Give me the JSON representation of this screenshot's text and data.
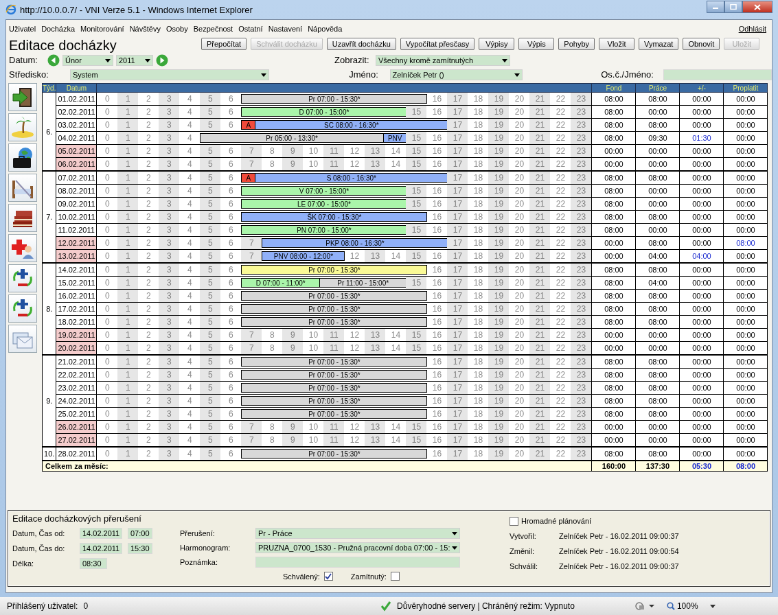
{
  "window": {
    "title": "http://10.0.0.7/ - VNI Verze 5.1 - Windows Internet Explorer"
  },
  "menu": [
    "Uživatel",
    "Docházka",
    "Monitorování",
    "Návštěvy",
    "Osoby",
    "Bezpečnost",
    "Ostatní",
    "Nastavení",
    "Nápověda"
  ],
  "logout": "Odhlásit",
  "page_title": "Editace docházky",
  "toolbar": [
    {
      "label": "Přepočítat",
      "disabled": false
    },
    {
      "label": "Schválit docházku",
      "disabled": true
    },
    {
      "label": "Uzavřít docházku",
      "disabled": false
    },
    {
      "label": "Vypočítat přesčasy",
      "disabled": false
    },
    {
      "label": "Výpisy",
      "disabled": false
    },
    {
      "label": "Výpis",
      "disabled": false
    },
    {
      "label": "Pohyby",
      "disabled": false
    },
    {
      "label": "Vložit",
      "disabled": false
    },
    {
      "label": "Vymazat",
      "disabled": false
    },
    {
      "label": "Obnovit",
      "disabled": false
    },
    {
      "label": "Uložit",
      "disabled": true
    }
  ],
  "filters": {
    "date_label": "Datum:",
    "month": "Únor",
    "year": "2011",
    "show_label": "Zobrazit:",
    "show": "Všechny kromě zamítnutých",
    "center_label": "Středisko:",
    "center": "System",
    "name_label": "Jméno:",
    "name": "Zelníček Petr ()",
    "id_label": "Os.č./Jméno:"
  },
  "sidebar": [
    {
      "kind": "exit"
    },
    {
      "kind": "vacation"
    },
    {
      "kind": "trip"
    },
    {
      "kind": "rest"
    },
    {
      "kind": "books"
    },
    {
      "kind": "medical"
    },
    {
      "kind": "cycle"
    },
    {
      "kind": "cycle"
    },
    {
      "kind": "cards"
    }
  ],
  "table": {
    "columns": {
      "week": "Týd.",
      "date": "Datum",
      "fond": "Fond",
      "work": "Práce",
      "diff": "+/-",
      "payout": "Proplatit"
    },
    "weeks": [
      {
        "label": "6.",
        "days": [
          {
            "date": "01.02.2011",
            "weekend": false,
            "hours_before": [
              "0",
              "1",
              "2",
              "3",
              "4",
              "5",
              "6"
            ],
            "bars": [
              {
                "label": "Pr 07:00 - 15:30*",
                "color": "#d8d8d8"
              }
            ],
            "hours_after": [
              "16",
              "17",
              "18",
              "19",
              "20",
              "21",
              "22",
              "23"
            ],
            "fond": "08:00",
            "work": "08:00",
            "diff": "00:00",
            "diff_marked": false,
            "payout": "00:00",
            "payout_marked": false
          },
          {
            "date": "02.02.2011",
            "weekend": false,
            "hours_before": [
              "0",
              "1",
              "2",
              "3",
              "4",
              "5",
              "6"
            ],
            "bars": [
              {
                "label": "D 07:00 - 15:00*",
                "color": "#aaf5aa"
              }
            ],
            "hours_after": [
              "15",
              "16",
              "17",
              "18",
              "19",
              "20",
              "21",
              "22",
              "23"
            ],
            "fond": "08:00",
            "work": "00:00",
            "diff": "00:00",
            "diff_marked": false,
            "payout": "00:00",
            "payout_marked": false
          },
          {
            "date": "03.02.2011",
            "weekend": false,
            "hours_before": [
              "0",
              "1",
              "2",
              "3",
              "4",
              "5",
              "6"
            ],
            "bars": [
              {
                "label": "A",
                "color": "#f04a3a"
              },
              {
                "label": "SC 08:00 - 16:30*",
                "color": "#90b0f8"
              }
            ],
            "hours_after": [
              "17",
              "18",
              "19",
              "20",
              "21",
              "22",
              "23"
            ],
            "fond": "08:00",
            "work": "08:00",
            "diff": "00:00",
            "diff_marked": false,
            "payout": "00:00",
            "payout_marked": false
          },
          {
            "date": "04.02.2011",
            "weekend": false,
            "hours_before": [
              "0",
              "1",
              "2",
              "3",
              "4"
            ],
            "bars": [
              {
                "label": "Pr 05:00 - 13:30*",
                "color": "#d8d8d8"
              },
              {
                "label": "PNV",
                "color": "#90b0f8"
              }
            ],
            "hours_after": [
              "15",
              "16",
              "17",
              "18",
              "19",
              "20",
              "21",
              "22",
              "23"
            ],
            "fond": "08:00",
            "work": "09:30",
            "diff": "01:30",
            "diff_marked": true,
            "payout": "00:00",
            "payout_marked": false
          },
          {
            "date": "05.02.2011",
            "weekend": true,
            "hours_before": [
              "0",
              "1",
              "2",
              "3",
              "4",
              "5",
              "6",
              "7",
              "8",
              "9",
              "10",
              "11",
              "12",
              "13",
              "14",
              "15",
              "16",
              "17",
              "18",
              "19",
              "20",
              "21",
              "22",
              "23"
            ],
            "fond": "00:00",
            "work": "00:00",
            "diff": "00:00",
            "diff_marked": false,
            "payout": "00:00",
            "payout_marked": false
          },
          {
            "date": "06.02.2011",
            "weekend": true,
            "hours_before": [
              "0",
              "1",
              "2",
              "3",
              "4",
              "5",
              "6",
              "7",
              "8",
              "9",
              "10",
              "11",
              "12",
              "13",
              "14",
              "15",
              "16",
              "17",
              "18",
              "19",
              "20",
              "21",
              "22",
              "23"
            ],
            "fond": "00:00",
            "work": "00:00",
            "diff": "00:00",
            "diff_marked": false,
            "payout": "00:00",
            "payout_marked": false
          }
        ]
      },
      {
        "label": "7.",
        "days": [
          {
            "date": "07.02.2011",
            "weekend": false,
            "hours_before": [
              "0",
              "1",
              "2",
              "3",
              "4",
              "5",
              "6"
            ],
            "bars": [
              {
                "label": "A",
                "color": "#f04a3a"
              },
              {
                "label": "S 08:00 - 16:30*",
                "color": "#90b0f8"
              }
            ],
            "hours_after": [
              "17",
              "18",
              "19",
              "20",
              "21",
              "22",
              "23"
            ],
            "fond": "08:00",
            "work": "08:00",
            "diff": "00:00",
            "diff_marked": false,
            "payout": "00:00",
            "payout_marked": false
          },
          {
            "date": "08.02.2011",
            "weekend": false,
            "hours_before": [
              "0",
              "1",
              "2",
              "3",
              "4",
              "5",
              "6"
            ],
            "bars": [
              {
                "label": "V 07:00 - 15:00*",
                "color": "#aaf5aa"
              }
            ],
            "hours_after": [
              "15",
              "16",
              "17",
              "18",
              "19",
              "20",
              "21",
              "22",
              "23"
            ],
            "fond": "08:00",
            "work": "00:00",
            "diff": "00:00",
            "diff_marked": false,
            "payout": "00:00",
            "payout_marked": false
          },
          {
            "date": "09.02.2011",
            "weekend": false,
            "hours_before": [
              "0",
              "1",
              "2",
              "3",
              "4",
              "5",
              "6"
            ],
            "bars": [
              {
                "label": "LE 07:00 - 15:00*",
                "color": "#aaf5aa"
              }
            ],
            "hours_after": [
              "15",
              "16",
              "17",
              "18",
              "19",
              "20",
              "21",
              "22",
              "23"
            ],
            "fond": "08:00",
            "work": "00:00",
            "diff": "00:00",
            "diff_marked": false,
            "payout": "00:00",
            "payout_marked": false
          },
          {
            "date": "10.02.2011",
            "weekend": false,
            "hours_before": [
              "0",
              "1",
              "2",
              "3",
              "4",
              "5",
              "6"
            ],
            "bars": [
              {
                "label": "ŠK 07:00 - 15:30*",
                "color": "#90b0f8"
              }
            ],
            "hours_after": [
              "16",
              "17",
              "18",
              "19",
              "20",
              "21",
              "22",
              "23"
            ],
            "fond": "08:00",
            "work": "08:00",
            "diff": "00:00",
            "diff_marked": false,
            "payout": "00:00",
            "payout_marked": false
          },
          {
            "date": "11.02.2011",
            "weekend": false,
            "hours_before": [
              "0",
              "1",
              "2",
              "3",
              "4",
              "5",
              "6"
            ],
            "bars": [
              {
                "label": "PN 07:00 - 15:00*",
                "color": "#aaf5aa"
              }
            ],
            "hours_after": [
              "15",
              "16",
              "17",
              "18",
              "19",
              "20",
              "21",
              "22",
              "23"
            ],
            "fond": "08:00",
            "work": "00:00",
            "diff": "00:00",
            "diff_marked": false,
            "payout": "00:00",
            "payout_marked": false
          },
          {
            "date": "12.02.2011",
            "weekend": true,
            "hours_before": [
              "0",
              "1",
              "2",
              "3",
              "4",
              "5",
              "6",
              "7"
            ],
            "bars": [
              {
                "label": "PKP 08:00 - 16:30*",
                "color": "#90b0f8"
              }
            ],
            "hours_after": [
              "17",
              "18",
              "19",
              "20",
              "21",
              "22",
              "23"
            ],
            "fond": "00:00",
            "work": "08:00",
            "diff": "00:00",
            "diff_marked": false,
            "payout": "08:00",
            "payout_marked": true
          },
          {
            "date": "13.02.2011",
            "weekend": true,
            "hours_before": [
              "0",
              "1",
              "2",
              "3",
              "4",
              "5",
              "6",
              "7"
            ],
            "bars": [
              {
                "label": "PNV 08:00 - 12:00*",
                "color": "#90b0f8"
              }
            ],
            "hours_after": [
              "12",
              "13",
              "14",
              "15",
              "16",
              "17",
              "18",
              "19",
              "20",
              "21",
              "22",
              "23"
            ],
            "fond": "00:00",
            "work": "04:00",
            "diff": "04:00",
            "diff_marked": true,
            "payout": "00:00",
            "payout_marked": false
          }
        ]
      },
      {
        "label": "8.",
        "days": [
          {
            "date": "14.02.2011",
            "weekend": false,
            "hours_before": [
              "0",
              "1",
              "2",
              "3",
              "4",
              "5",
              "6"
            ],
            "bars": [
              {
                "label": "Pr 07:00 - 15:30*",
                "color": "#fafa96"
              }
            ],
            "hours_after": [
              "16",
              "17",
              "18",
              "19",
              "20",
              "21",
              "22",
              "23"
            ],
            "fond": "08:00",
            "work": "08:00",
            "diff": "00:00",
            "diff_marked": false,
            "payout": "00:00",
            "payout_marked": false
          },
          {
            "date": "15.02.2011",
            "weekend": false,
            "hours_before": [
              "0",
              "1",
              "2",
              "3",
              "4",
              "5",
              "6"
            ],
            "bars": [
              {
                "label": "D 07:00 - 11:00*",
                "color": "#aaf5aa"
              },
              {
                "label": "Pr 11:00 - 15:00*",
                "color": "#d8d8d8"
              }
            ],
            "hours_after": [
              "15",
              "16",
              "17",
              "18",
              "19",
              "20",
              "21",
              "22",
              "23"
            ],
            "fond": "08:00",
            "work": "04:00",
            "diff": "00:00",
            "diff_marked": false,
            "payout": "00:00",
            "payout_marked": false
          },
          {
            "date": "16.02.2011",
            "weekend": false,
            "hours_before": [
              "0",
              "1",
              "2",
              "3",
              "4",
              "5",
              "6"
            ],
            "bars": [
              {
                "label": "Pr 07:00 - 15:30*",
                "color": "#d8d8d8"
              }
            ],
            "hours_after": [
              "16",
              "17",
              "18",
              "19",
              "20",
              "21",
              "22",
              "23"
            ],
            "fond": "08:00",
            "work": "08:00",
            "diff": "00:00",
            "diff_marked": false,
            "payout": "00:00",
            "payout_marked": false
          },
          {
            "date": "17.02.2011",
            "weekend": false,
            "hours_before": [
              "0",
              "1",
              "2",
              "3",
              "4",
              "5",
              "6"
            ],
            "bars": [
              {
                "label": "Pr 07:00 - 15:30*",
                "color": "#d8d8d8"
              }
            ],
            "hours_after": [
              "16",
              "17",
              "18",
              "19",
              "20",
              "21",
              "22",
              "23"
            ],
            "fond": "08:00",
            "work": "08:00",
            "diff": "00:00",
            "diff_marked": false,
            "payout": "00:00",
            "payout_marked": false
          },
          {
            "date": "18.02.2011",
            "weekend": false,
            "hours_before": [
              "0",
              "1",
              "2",
              "3",
              "4",
              "5",
              "6"
            ],
            "bars": [
              {
                "label": "Pr 07:00 - 15:30*",
                "color": "#d8d8d8"
              }
            ],
            "hours_after": [
              "16",
              "17",
              "18",
              "19",
              "20",
              "21",
              "22",
              "23"
            ],
            "fond": "08:00",
            "work": "08:00",
            "diff": "00:00",
            "diff_marked": false,
            "payout": "00:00",
            "payout_marked": false
          },
          {
            "date": "19.02.2011",
            "weekend": true,
            "hours_before": [
              "0",
              "1",
              "2",
              "3",
              "4",
              "5",
              "6",
              "7",
              "8",
              "9",
              "10",
              "11",
              "12",
              "13",
              "14",
              "15",
              "16",
              "17",
              "18",
              "19",
              "20",
              "21",
              "22",
              "23"
            ],
            "fond": "00:00",
            "work": "00:00",
            "diff": "00:00",
            "diff_marked": false,
            "payout": "00:00",
            "payout_marked": false
          },
          {
            "date": "20.02.2011",
            "weekend": true,
            "hours_before": [
              "0",
              "1",
              "2",
              "3",
              "4",
              "5",
              "6",
              "7",
              "8",
              "9",
              "10",
              "11",
              "12",
              "13",
              "14",
              "15",
              "16",
              "17",
              "18",
              "19",
              "20",
              "21",
              "22",
              "23"
            ],
            "fond": "00:00",
            "work": "00:00",
            "diff": "00:00",
            "diff_marked": false,
            "payout": "00:00",
            "payout_marked": false
          }
        ]
      },
      {
        "label": "9.",
        "days": [
          {
            "date": "21.02.2011",
            "weekend": false,
            "hours_before": [
              "0",
              "1",
              "2",
              "3",
              "4",
              "5",
              "6"
            ],
            "bars": [
              {
                "label": "Pr 07:00 - 15:30*",
                "color": "#d8d8d8"
              }
            ],
            "hours_after": [
              "16",
              "17",
              "18",
              "19",
              "20",
              "21",
              "22",
              "23"
            ],
            "fond": "08:00",
            "work": "08:00",
            "diff": "00:00",
            "diff_marked": false,
            "payout": "00:00",
            "payout_marked": false
          },
          {
            "date": "22.02.2011",
            "weekend": false,
            "hours_before": [
              "0",
              "1",
              "2",
              "3",
              "4",
              "5",
              "6"
            ],
            "bars": [
              {
                "label": "Pr 07:00 - 15:30*",
                "color": "#d8d8d8"
              }
            ],
            "hours_after": [
              "16",
              "17",
              "18",
              "19",
              "20",
              "21",
              "22",
              "23"
            ],
            "fond": "08:00",
            "work": "08:00",
            "diff": "00:00",
            "diff_marked": false,
            "payout": "00:00",
            "payout_marked": false
          },
          {
            "date": "23.02.2011",
            "weekend": false,
            "hours_before": [
              "0",
              "1",
              "2",
              "3",
              "4",
              "5",
              "6"
            ],
            "bars": [
              {
                "label": "Pr 07:00 - 15:30*",
                "color": "#d8d8d8"
              }
            ],
            "hours_after": [
              "16",
              "17",
              "18",
              "19",
              "20",
              "21",
              "22",
              "23"
            ],
            "fond": "08:00",
            "work": "08:00",
            "diff": "00:00",
            "diff_marked": false,
            "payout": "00:00",
            "payout_marked": false
          },
          {
            "date": "24.02.2011",
            "weekend": false,
            "hours_before": [
              "0",
              "1",
              "2",
              "3",
              "4",
              "5",
              "6"
            ],
            "bars": [
              {
                "label": "Pr 07:00 - 15:30*",
                "color": "#d8d8d8"
              }
            ],
            "hours_after": [
              "16",
              "17",
              "18",
              "19",
              "20",
              "21",
              "22",
              "23"
            ],
            "fond": "08:00",
            "work": "08:00",
            "diff": "00:00",
            "diff_marked": false,
            "payout": "00:00",
            "payout_marked": false
          },
          {
            "date": "25.02.2011",
            "weekend": false,
            "hours_before": [
              "0",
              "1",
              "2",
              "3",
              "4",
              "5",
              "6"
            ],
            "bars": [
              {
                "label": "Pr 07:00 - 15:30*",
                "color": "#d8d8d8"
              }
            ],
            "hours_after": [
              "16",
              "17",
              "18",
              "19",
              "20",
              "21",
              "22",
              "23"
            ],
            "fond": "08:00",
            "work": "08:00",
            "diff": "00:00",
            "diff_marked": false,
            "payout": "00:00",
            "payout_marked": false
          },
          {
            "date": "26.02.2011",
            "weekend": true,
            "hours_before": [
              "0",
              "1",
              "2",
              "3",
              "4",
              "5",
              "6",
              "7",
              "8",
              "9",
              "10",
              "11",
              "12",
              "13",
              "14",
              "15",
              "16",
              "17",
              "18",
              "19",
              "20",
              "21",
              "22",
              "23"
            ],
            "fond": "00:00",
            "work": "00:00",
            "diff": "00:00",
            "diff_marked": false,
            "payout": "00:00",
            "payout_marked": false
          },
          {
            "date": "27.02.2011",
            "weekend": true,
            "hours_before": [
              "0",
              "1",
              "2",
              "3",
              "4",
              "5",
              "6",
              "7",
              "8",
              "9",
              "10",
              "11",
              "12",
              "13",
              "14",
              "15",
              "16",
              "17",
              "18",
              "19",
              "20",
              "21",
              "22",
              "23"
            ],
            "fond": "00:00",
            "work": "00:00",
            "diff": "00:00",
            "diff_marked": false,
            "payout": "00:00",
            "payout_marked": false
          }
        ]
      },
      {
        "label": "10.",
        "days": [
          {
            "date": "28.02.2011",
            "weekend": false,
            "hours_before": [
              "0",
              "1",
              "2",
              "3",
              "4",
              "5",
              "6"
            ],
            "bars": [
              {
                "label": "Pr 07:00 - 15:30*",
                "color": "#d8d8d8"
              }
            ],
            "hours_after": [
              "16",
              "17",
              "18",
              "19",
              "20",
              "21",
              "22",
              "23"
            ],
            "fond": "08:00",
            "work": "08:00",
            "diff": "00:00",
            "diff_marked": false,
            "payout": "00:00",
            "payout_marked": false
          }
        ]
      }
    ],
    "total": {
      "label": "Celkem za měsíc:",
      "fond": "160:00",
      "work": "137:30",
      "diff": "05:30",
      "diff_marked": true,
      "payout": "08:00",
      "payout_marked": true
    }
  },
  "editor": {
    "title": "Editace docházkových přerušení",
    "from_label": "Datum, Čas od:",
    "from_date": "14.02.2011",
    "from_time": "07:00",
    "to_label": "Datum, Čas do:",
    "to_date": "14.02.2011",
    "to_time": "15:30",
    "length_label": "Délka:",
    "length": "08:30",
    "break_label": "Přerušení:",
    "break": "Pr - Práce",
    "schedule_label": "Harmonogram:",
    "schedule": "PRUZNA_0700_1530 - Pružná pracovní doba 07:00 - 15:",
    "note_label": "Poznámka:",
    "approved_label": "Schválený:",
    "approved": true,
    "rejected_label": "Zamítnutý:",
    "rejected": false,
    "bulk_label": "Hromadné plánování",
    "bulk": false,
    "created_label": "Vytvořil:",
    "created": "Zelníček Petr - 16.02.2011 09:00:37",
    "changed_label": "Změnil:",
    "changed": "Zelníček Petr - 16.02.2011 09:00:54",
    "approved_by_label": "Schválil:",
    "approved_by": "Zelníček Petr - 16.02.2011 09:00:37"
  },
  "status_bar": {
    "user_label": "Přihlášený uživatel:",
    "user": "0",
    "zone": "Důvěryhodné servery | Chráněný režim: Vypnuto",
    "zoom": "100%"
  }
}
